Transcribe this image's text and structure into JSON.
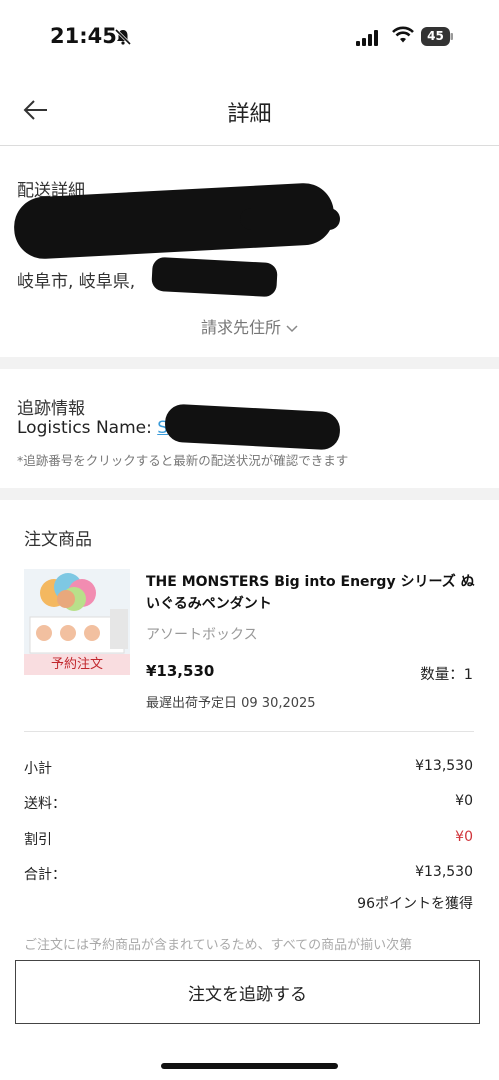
{
  "status_bar": {
    "time": "21:45",
    "battery_level": "45",
    "icons": [
      "bell-slash-icon",
      "cellular-signal-icon",
      "wifi-icon",
      "battery-icon"
    ]
  },
  "header": {
    "title": "詳細",
    "back_icon": "arrow-left-icon"
  },
  "delivery": {
    "title": "配送詳細",
    "city_line": "岐阜市, 岐阜県,",
    "billing_toggle": "請求先住所",
    "toggle_icon": "chevron-down-icon"
  },
  "tracking": {
    "title": "追跡情報",
    "logistics_label": "Logistics Name:",
    "note": "*追跡番号をクリックすると最新の配送状況が確認できます"
  },
  "order": {
    "title": "注文商品",
    "product": {
      "name": "THE MONSTERS Big into Energy シリーズ ぬいぐるみペンダント",
      "variant": "アソートボックス",
      "price": "¥13,530",
      "quantity": "数量：1",
      "ship_date": "最遅出荷予定日 09 30,2025",
      "badge": "予約注文"
    },
    "summary": {
      "subtotal_label": "小計",
      "subtotal": "¥13,530",
      "shipping_label": "送料：",
      "shipping": "¥0",
      "discount_label": "割引",
      "discount": "¥0",
      "total_label": "合計：",
      "total": "¥13,530",
      "points": "96ポイントを獲得"
    },
    "notice": "ご注文には予約商品が含まれているため、すべての商品が揃い次第"
  },
  "actions": {
    "track_order": "注文を追跡する"
  },
  "colors": {
    "link": "#3a9bd9",
    "discount": "#d0343a",
    "preorder_bg": "#f9dde0",
    "preorder_text": "#c1272d"
  }
}
